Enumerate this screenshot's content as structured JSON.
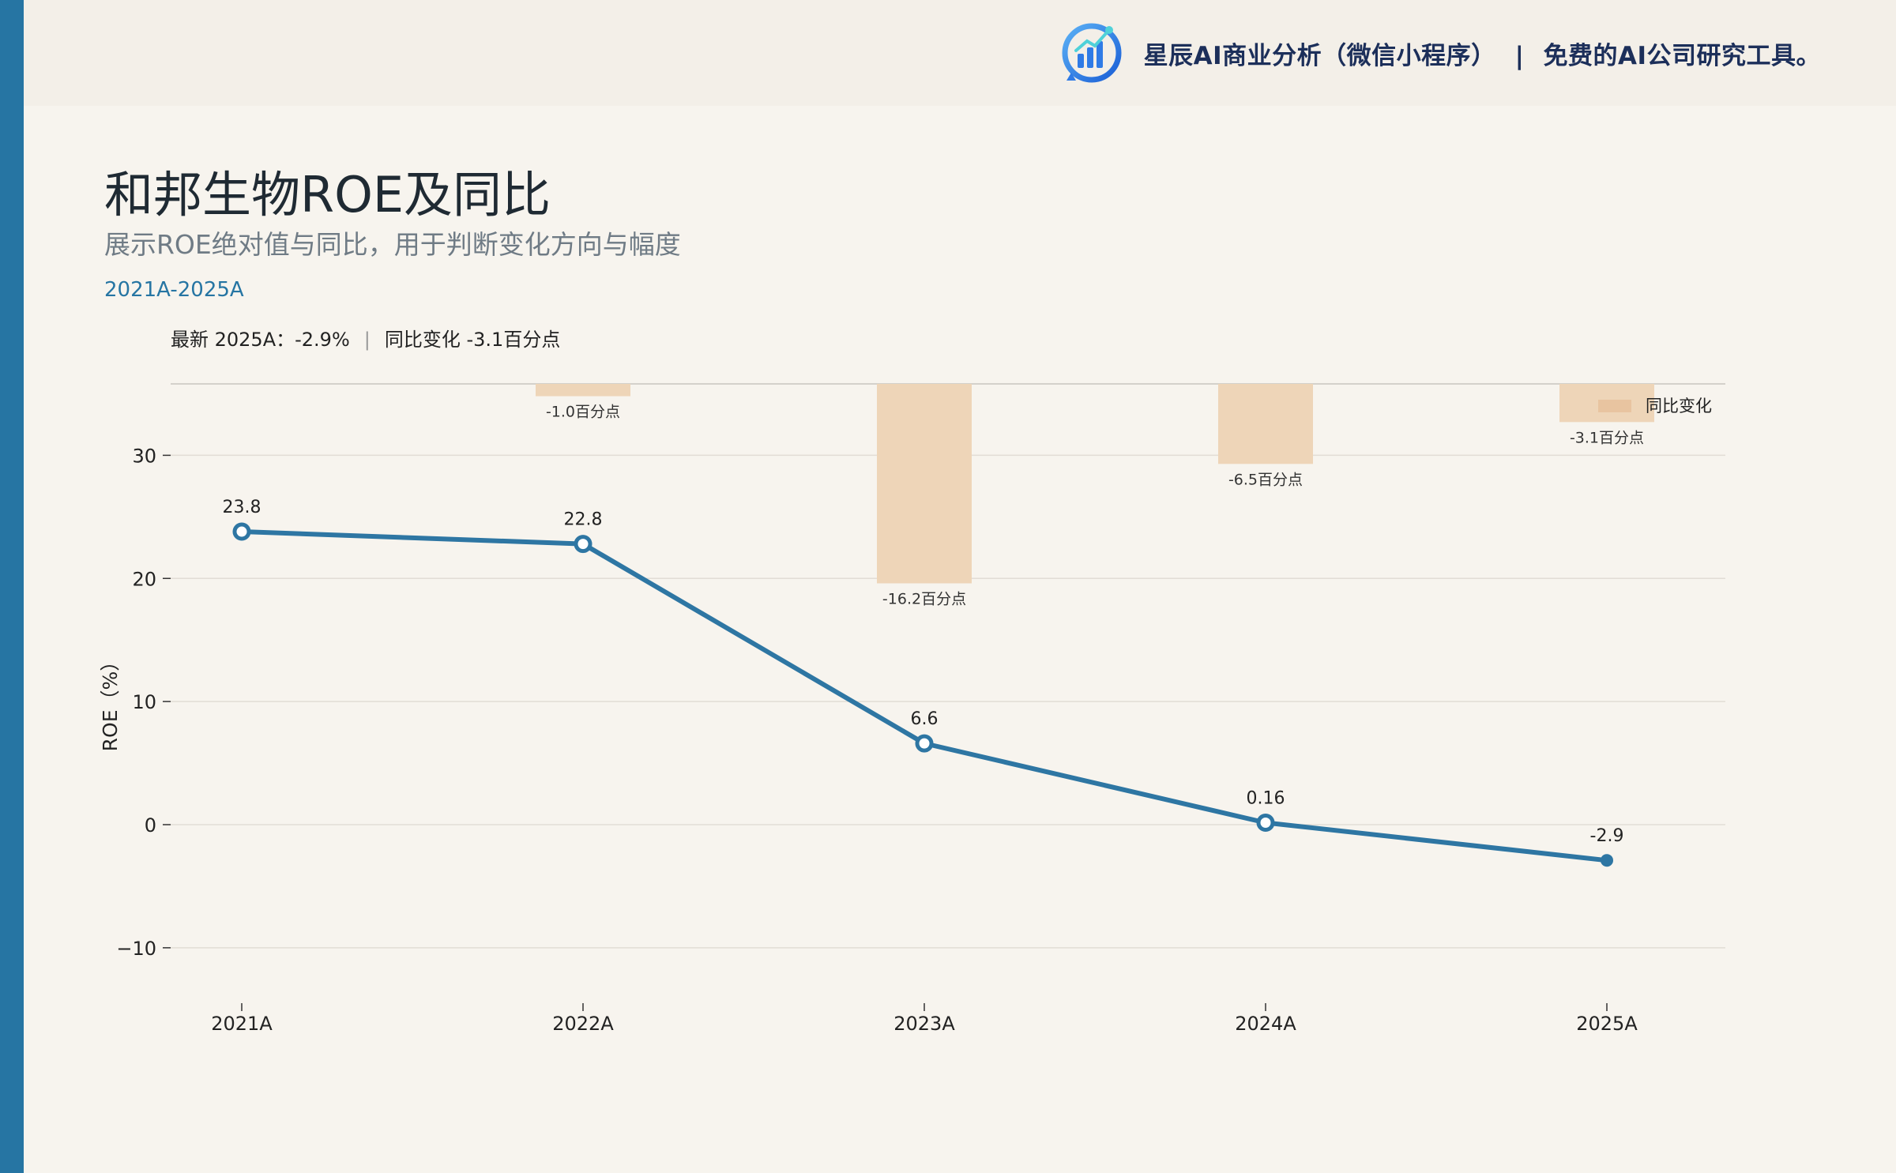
{
  "header": {
    "brand_name": "星辰AI商业分析（微信小程序）",
    "separator": "|",
    "tagline": "免费的AI公司研究工具。",
    "logo_icon": "bar-chart-logo-icon"
  },
  "page": {
    "title": "和邦生物ROE及同比",
    "subtitle": "展示ROE绝对值与同比，用于判断变化方向与幅度",
    "period": "2021A-2025A",
    "summary_left": "最新 2025A：-2.9%",
    "summary_sep": "|",
    "summary_right": "同比变化 -3.1百分点"
  },
  "colors": {
    "accent": "#2675a3",
    "line": "#2e76a3",
    "bar": "#eed5b8",
    "legend_bar": "#e8c4a0",
    "background": "#f7f4ee"
  },
  "chart_data": {
    "type": "line",
    "categories": [
      "2021A",
      "2022A",
      "2023A",
      "2024A",
      "2025A"
    ],
    "ylabel": "ROE（%）",
    "xlabel": "",
    "ylim": [
      -14.5,
      35.8
    ],
    "yticks": [
      -10,
      0,
      10,
      20,
      30
    ],
    "ytick_labels": [
      "−10",
      "0",
      "10",
      "20",
      "30"
    ],
    "grid": true,
    "series": [
      {
        "kind": "line",
        "values": [
          23.8,
          22.8,
          6.6,
          0.16,
          -2.9
        ],
        "labels": [
          "23.8",
          "22.8",
          "6.6",
          "0.16",
          "-2.9"
        ]
      },
      {
        "kind": "bar",
        "name": "同比变化",
        "values": [
          null,
          -1.0,
          -16.2,
          -6.5,
          -3.1
        ],
        "labels": [
          "",
          "-1.0百分点",
          "-16.2百分点",
          "-6.5百分点",
          "-3.1百分点"
        ]
      }
    ],
    "legend_position": "top-right"
  }
}
